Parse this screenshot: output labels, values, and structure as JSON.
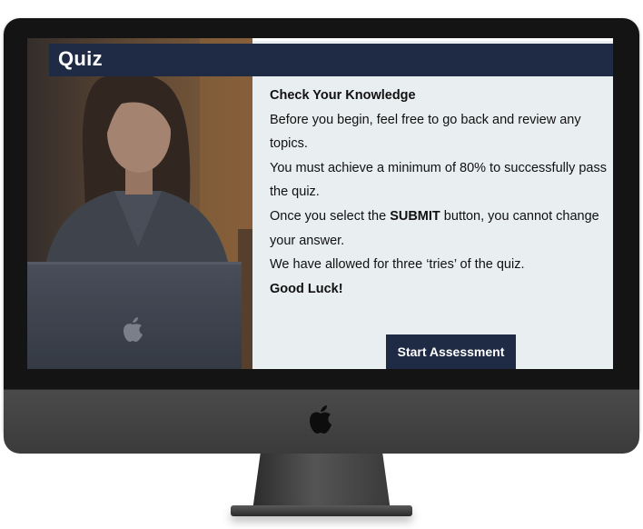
{
  "quiz": {
    "title": "Quiz",
    "heading": "Check Your Knowledge",
    "line1": "Before you begin, feel free to go back and review any topics.",
    "line2": "You must achieve a minimum of 80% to successfully pass the quiz.",
    "line3_before": "Once you select the ",
    "line3_bold": "SUBMIT",
    "line3_after": " button, you cannot change your answer.",
    "line4": "We have allowed for three ‘tries’ of the quiz.",
    "closing": "Good Luck!",
    "start_button_label": "Start Assessment"
  },
  "icons": {
    "monitor_logo": "apple-logo-icon",
    "laptop_logo": "apple-logo-icon"
  },
  "colors": {
    "title_bar": "#1f2b44",
    "button": "#1f2b44",
    "panel_background": "#e9eef0",
    "bezel": "#141414"
  }
}
